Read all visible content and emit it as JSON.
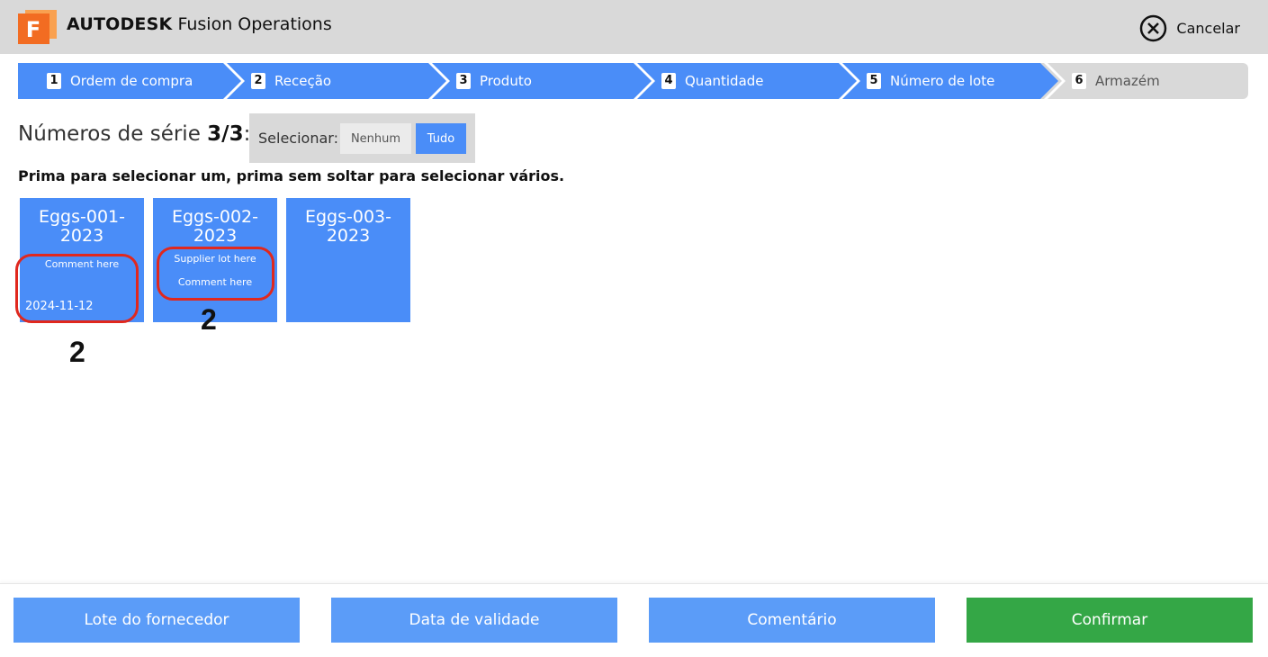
{
  "header": {
    "logo_letter": "F",
    "brand_bold": "AUTODESK",
    "brand_rest": "Fusion Operations",
    "cancel_label": "Cancelar"
  },
  "stepper": [
    {
      "num": "1",
      "label": "Ordem de compra",
      "state": "done"
    },
    {
      "num": "2",
      "label": "Receção",
      "state": "done"
    },
    {
      "num": "3",
      "label": "Produto",
      "state": "done"
    },
    {
      "num": "4",
      "label": "Quantidade",
      "state": "done"
    },
    {
      "num": "5",
      "label": "Número de lote",
      "state": "done"
    },
    {
      "num": "6",
      "label": "Armazém",
      "state": "todo"
    }
  ],
  "serials": {
    "title": "Números de série",
    "count": "3/3",
    "colon": ":",
    "select_label": "Selecionar:",
    "select_none": "Nenhum",
    "select_all": "Tudo",
    "instruction": "Prima para selecionar um, prima sem soltar para selecionar vários."
  },
  "tiles": [
    {
      "line1": "Eggs-001-",
      "line2": "2023",
      "comment": "Comment here",
      "date": "2024-11-12"
    },
    {
      "line1": "Eggs-002-",
      "line2": "2023",
      "supplier_lot": "Supplier lot here",
      "comment": "Comment here"
    },
    {
      "line1": "Eggs-003-",
      "line2": "2023"
    }
  ],
  "annotations": {
    "label_1": "2",
    "label_2": "2",
    "color": "#e0281e"
  },
  "footer": {
    "supplier_lot": "Lote do fornecedor",
    "expiry_date": "Data de validade",
    "comment": "Comentário",
    "confirm": "Confirmar"
  },
  "colors": {
    "accent": "#4a8df8",
    "footer_blue": "#5b9cf8",
    "confirm_green": "#34a746",
    "header_gray": "#d9d9d9",
    "logo_orange": "#f26c22"
  }
}
